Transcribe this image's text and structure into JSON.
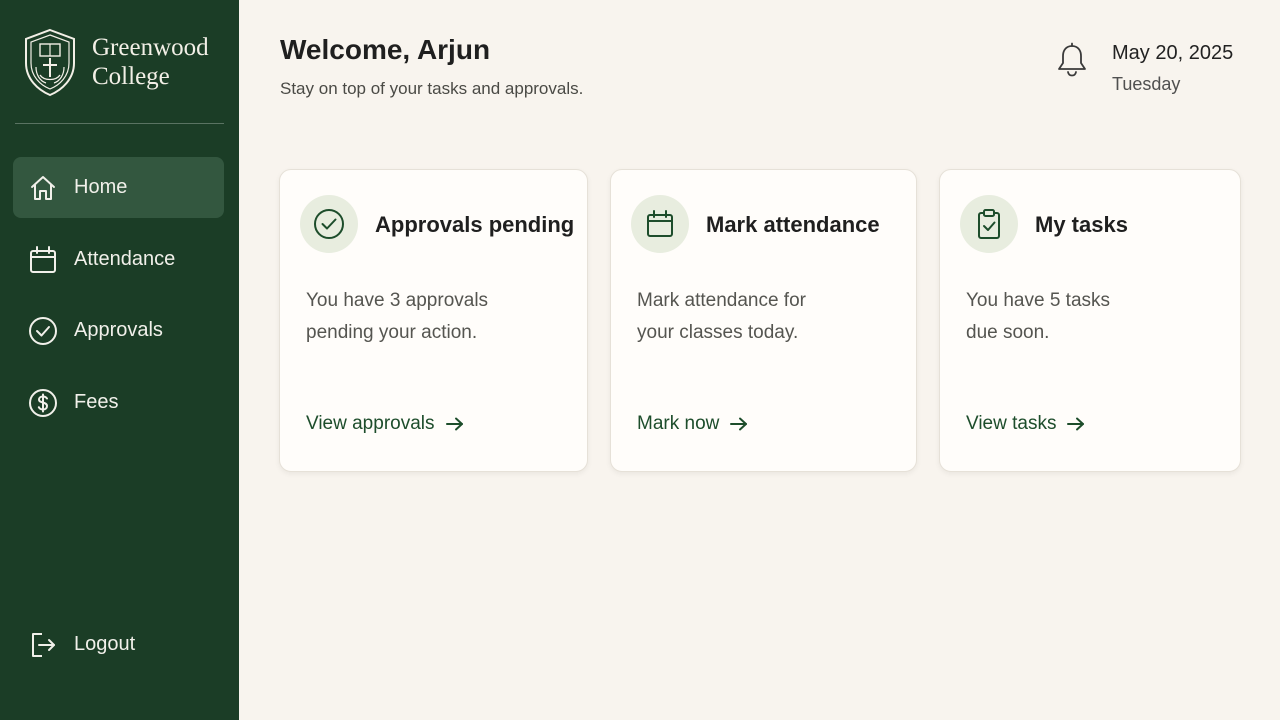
{
  "sidebar": {
    "brand": {
      "line1": "Greenwood",
      "line2": "College"
    },
    "items": [
      {
        "label": "Home",
        "icon": "home-icon",
        "active": true
      },
      {
        "label": "Attendance",
        "icon": "calendar-icon",
        "active": false
      },
      {
        "label": "Approvals",
        "icon": "check-circle-icon",
        "active": false
      },
      {
        "label": "Fees",
        "icon": "dollar-circle-icon",
        "active": false
      }
    ],
    "logout": {
      "label": "Logout",
      "icon": "logout-icon"
    }
  },
  "header": {
    "title": "Welcome, Arjun",
    "subtitle": "Stay on top of your tasks and approvals.",
    "date": "May 20, 2025",
    "day": "Tuesday"
  },
  "cards": [
    {
      "title": "Approvals pending",
      "icon": "check-circle-icon",
      "line1": "You have 3 approvals",
      "line2": "pending your action.",
      "link": "View approvals"
    },
    {
      "title": "Mark attendance",
      "icon": "calendar-icon",
      "line1": "Mark attendance for",
      "line2": "your classes today.",
      "link": "Mark now"
    },
    {
      "title": "My tasks",
      "icon": "clipboard-check-icon",
      "line1": "You have 5 tasks",
      "line2": "due soon.",
      "link": "View tasks"
    }
  ],
  "colors": {
    "sidebar": "#1b3d26",
    "active_item": "#33573f",
    "background": "#f8f4ee",
    "accent": "#1d4d2b",
    "icon_circle": "#e8eddf"
  }
}
